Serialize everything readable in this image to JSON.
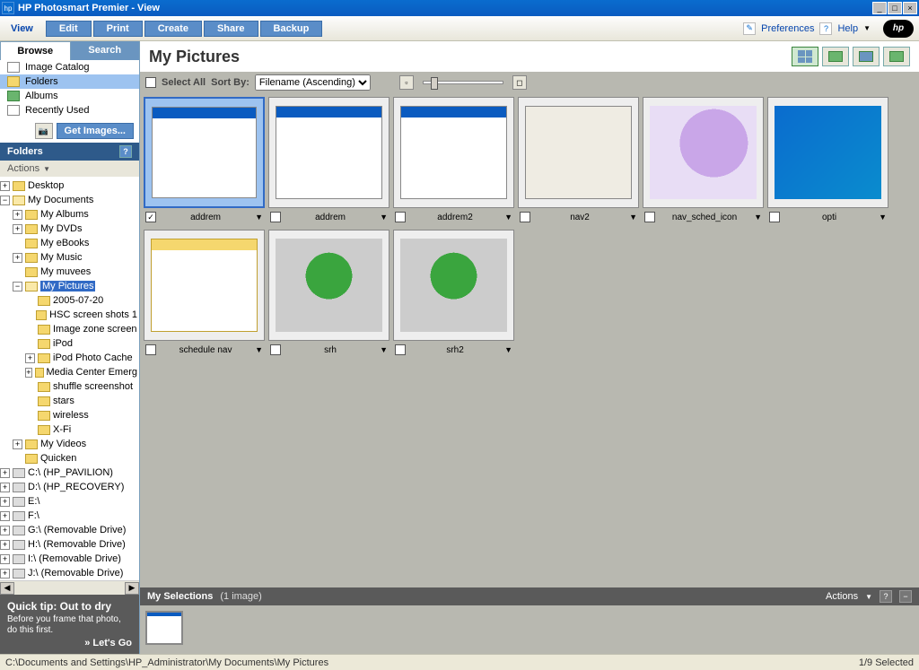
{
  "titlebar": {
    "title": "HP Photosmart Premier - View"
  },
  "toolbar": {
    "view": "View",
    "buttons": [
      "Edit",
      "Print",
      "Create",
      "Share",
      "Backup"
    ],
    "preferences": "Preferences",
    "help": "Help"
  },
  "sidebar": {
    "tabs": {
      "browse": "Browse",
      "search": "Search"
    },
    "cats": [
      "Image Catalog",
      "Folders",
      "Albums",
      "Recently Used"
    ],
    "get_images": "Get Images...",
    "folders_hdr": "Folders",
    "actions": "Actions"
  },
  "tree": {
    "desktop": "Desktop",
    "my_documents": "My Documents",
    "my_albums": "My Albums",
    "my_dvds": "My DVDs",
    "my_ebooks": "My eBooks",
    "my_music": "My Music",
    "my_muvees": "My muvees",
    "my_pictures": "My Pictures",
    "d2005": "2005-07-20",
    "hsc": "HSC screen shots 1",
    "imagezone": "Image zone screen",
    "ipod": "iPod",
    "ipod_cache": "iPod Photo Cache",
    "media_center": "Media Center Emerg",
    "shuffle": "shuffle screenshot",
    "stars": "stars",
    "wireless": "wireless",
    "xfi": "X-Fi",
    "my_videos": "My Videos",
    "quicken": "Quicken",
    "c_drive": "C:\\ (HP_PAVILION)",
    "d_drive": "D:\\ (HP_RECOVERY)",
    "e_drive": "E:\\",
    "f_drive": "F:\\",
    "g_drive": "G:\\ (Removable Drive)",
    "h_drive": "H:\\ (Removable Drive)",
    "i_drive": "I:\\ (Removable Drive)",
    "j_drive": "J:\\ (Removable Drive)"
  },
  "quicktip": {
    "title": "Quick tip: Out to dry",
    "body": "Before you frame that photo, do this first.",
    "go": "» Let's Go"
  },
  "content": {
    "crumb": "My Pictures",
    "select_all": "Select All",
    "sort_by": "Sort By:",
    "sort_value": "Filename (Ascending)"
  },
  "thumbs": {
    "r0c0": "addrem",
    "r0c1": "addrem",
    "r0c2": "addrem2",
    "r0c3": "nav2",
    "r0c4": "nav_sched_icon",
    "r0c5": "opti",
    "r1c0": "schedule nav",
    "r1c1": "srh",
    "r1c2": "srh2"
  },
  "selections": {
    "label": "My Selections",
    "count": "(1 image)",
    "actions": "Actions"
  },
  "statusbar": {
    "path": "C:\\Documents and Settings\\HP_Administrator\\My Documents\\My Pictures",
    "selected": "1/9 Selected"
  }
}
